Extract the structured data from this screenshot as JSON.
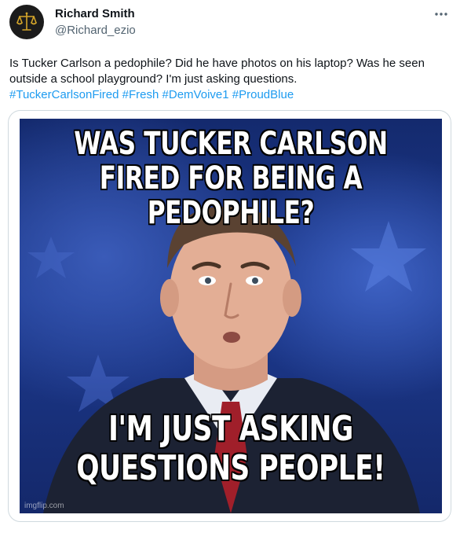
{
  "author": {
    "name": "Richard Smith",
    "handle": "@Richard_ezio",
    "avatar_icon": "scales-of-justice-icon",
    "avatar_color": "#1b1b1b",
    "avatar_accent": "#d4a52a"
  },
  "more_icon": "ellipsis-icon",
  "tweet": {
    "text": "Is Tucker Carlson a pedophile? Did he have photos on his laptop? Was he seen outside a school playground? I'm just asking questions.",
    "hashtags": [
      "#TuckerCarlsonFired",
      "#Fresh",
      "#DemVoive1",
      "#ProudBlue"
    ],
    "hashtag_color": "#1d9bf0"
  },
  "meme": {
    "top_line_1": "WAS TUCKER CARLSON",
    "top_line_2": "FIRED FOR BEING A PEDOPHILE?",
    "bottom_line_1": "I'M JUST ASKING",
    "bottom_line_2": "QUESTIONS PEOPLE!",
    "watermark": "imgflip.com"
  }
}
